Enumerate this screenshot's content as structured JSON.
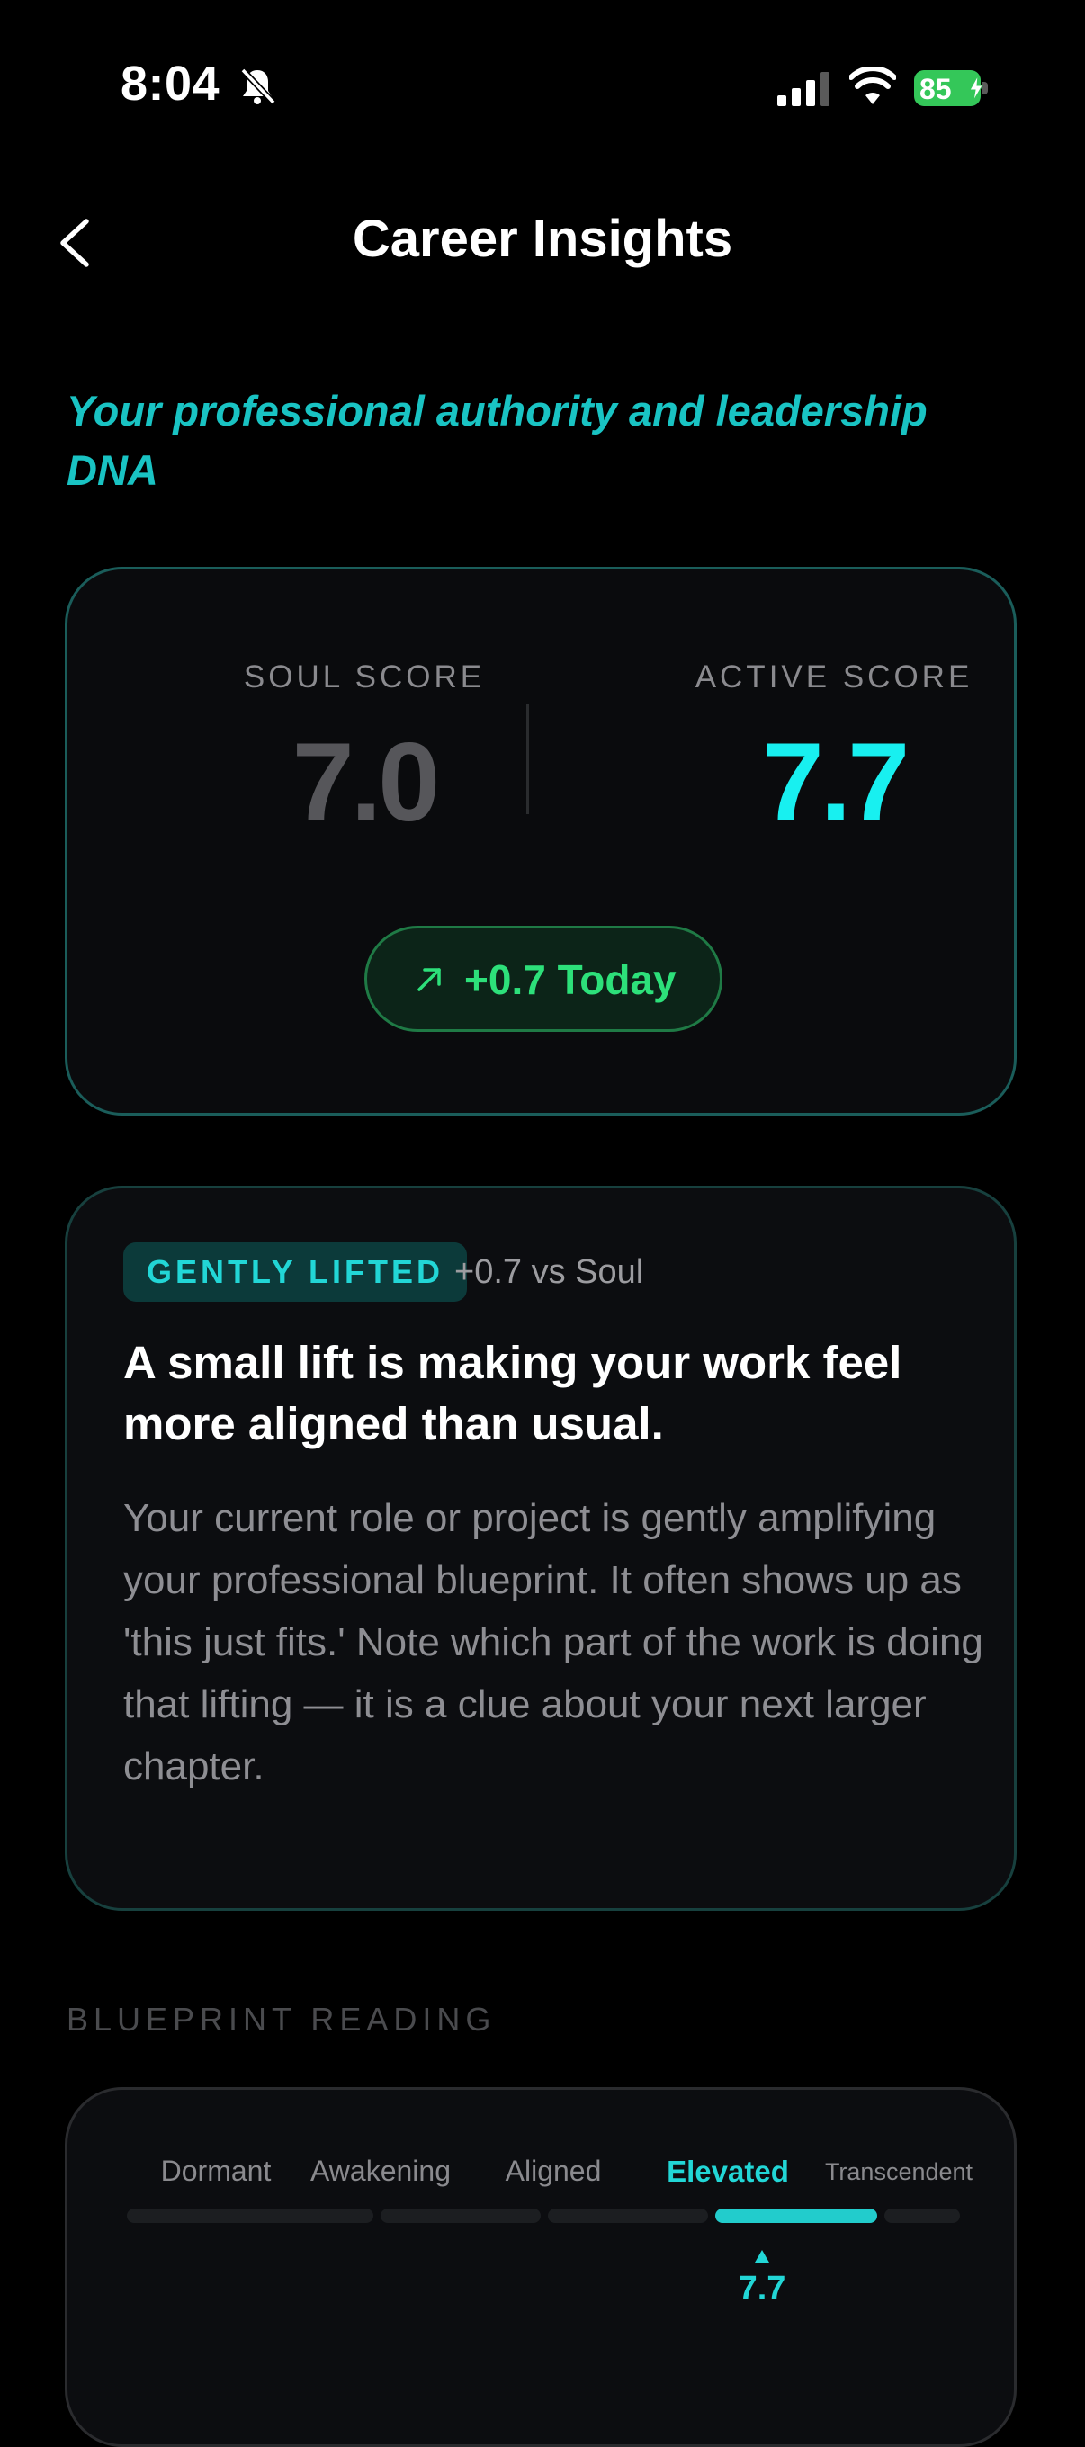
{
  "status": {
    "time": "8:04",
    "battery": "85"
  },
  "nav": {
    "title": "Career Insights"
  },
  "subtitle": "Your professional authority and leadership DNA",
  "scores": {
    "soul_label": "SOUL SCORE",
    "soul_value": "7.0",
    "active_label": "ACTIVE SCORE",
    "active_value": "7.7",
    "today_change": "+0.7 Today"
  },
  "insight": {
    "badge": "GENTLY LIFTED",
    "badge_note": "+0.7 vs Soul",
    "heading": "A small lift is making your work feel more aligned than usual.",
    "body": "Your current role or project is gently amplifying your professional blueprint. It often shows up as 'this just fits.' Note which part of the work is doing that lifting — it is a clue about your next larger chapter."
  },
  "blueprint": {
    "section_title": "BLUEPRINT READING",
    "levels": [
      "Dormant",
      "Awakening",
      "Aligned",
      "Elevated",
      "Transcendent"
    ],
    "current_level": "Elevated",
    "current_value": "7.7"
  },
  "colors": {
    "accent": "#19c3c3",
    "active_score": "#18f0f0",
    "positive": "#2de07a",
    "background": "#000000"
  },
  "icons": [
    "bell-slash-icon",
    "cellular-signal-icon",
    "wifi-icon",
    "battery-charging-icon",
    "back-chevron-icon",
    "trend-up-arrow-icon"
  ]
}
